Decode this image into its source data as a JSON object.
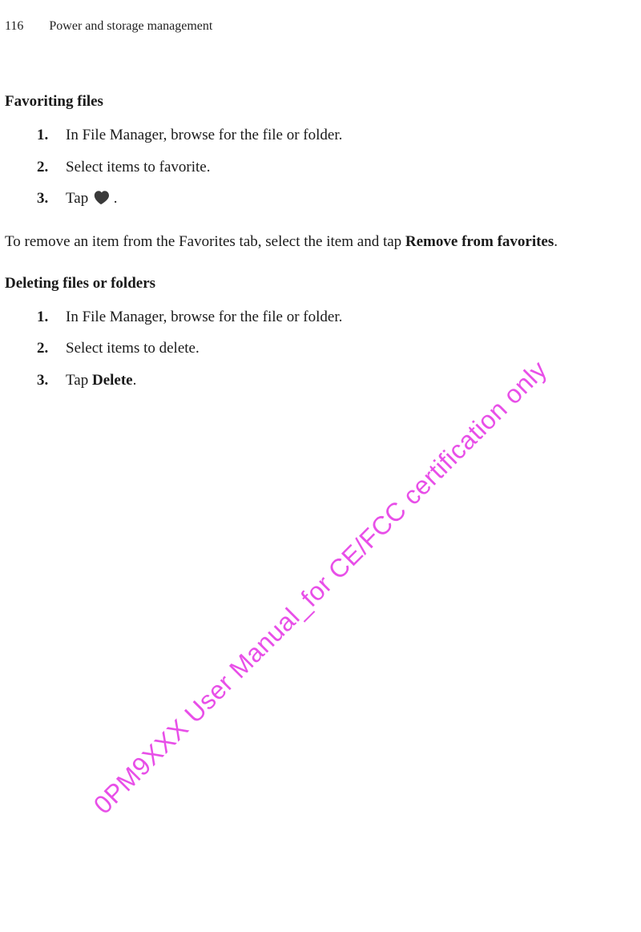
{
  "header": {
    "page_number": "116",
    "title": "Power and storage management"
  },
  "sections": [
    {
      "title": "Favoriting files",
      "steps": [
        "In File Manager, browse for the file or folder.",
        "Select items to favorite.",
        {
          "prefix": "Tap ",
          "icon": "heart-icon",
          "suffix": " ."
        }
      ],
      "after_para": {
        "prefix": "To remove an item from the Favorites tab, select the item and tap ",
        "bold": "Remove from favorites",
        "suffix": "."
      }
    },
    {
      "title": "Deleting files or folders",
      "steps": [
        "In File Manager, browse for the file or folder.",
        "Select items to delete.",
        {
          "prefix": "Tap ",
          "bold": "Delete",
          "suffix": "."
        }
      ]
    }
  ],
  "watermark": "0PM9XXX User Manual_for CE/FCC certification only"
}
